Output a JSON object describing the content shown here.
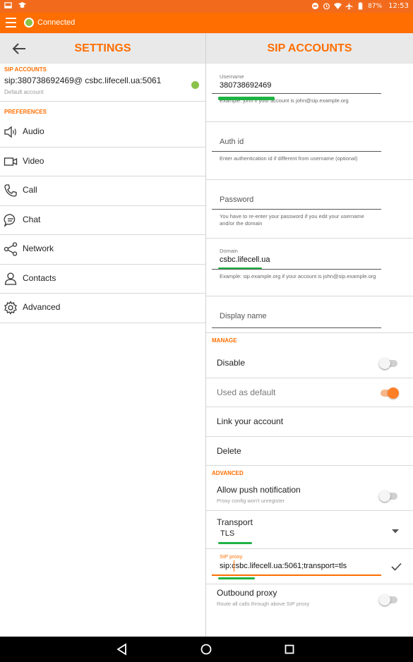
{
  "status_bar": {
    "battery": "87%",
    "time": "12:53"
  },
  "app_bar": {
    "connection_status": "Connected",
    "status_color": "#8bc34a",
    "accent": "#ff6e00"
  },
  "settings": {
    "title": "SETTINGS",
    "sip_section": "SIP ACCOUNTS",
    "account": {
      "address": "sip:380738692469@ csbc.lifecell.ua:5061",
      "subtitle": "Default account"
    },
    "pref_section": "PREFERENCES",
    "items": [
      {
        "label": "Audio",
        "icon": "speaker-icon"
      },
      {
        "label": "Video",
        "icon": "video-camera-icon"
      },
      {
        "label": "Call",
        "icon": "phone-icon"
      },
      {
        "label": "Chat",
        "icon": "chat-bubble-icon"
      },
      {
        "label": "Network",
        "icon": "share-network-icon"
      },
      {
        "label": "Contacts",
        "icon": "person-icon"
      },
      {
        "label": "Advanced",
        "icon": "gear-icon"
      }
    ]
  },
  "sip_account": {
    "title": "SIP ACCOUNTS",
    "username": {
      "label": "Username",
      "value": "380738692469",
      "hint": "Example: john if your account is john@sip.example.org"
    },
    "auth_id": {
      "placeholder": "Auth id",
      "hint": "Enter authentication id if different from username (optional)"
    },
    "password": {
      "placeholder": "Password",
      "hint": "You have to re-enter your password if you edit your username and/or the domain"
    },
    "domain": {
      "label": "Domain",
      "value": "csbc.lifecell.ua",
      "hint": "Example: sip.example.org if your account is john@sip.example.org"
    },
    "display_name": {
      "placeholder": "Display name"
    },
    "manage_section": "MANAGE",
    "disable": {
      "label": "Disable",
      "on": false
    },
    "used_as_default": {
      "label": "Used as default",
      "on": true
    },
    "link_account": "Link your account",
    "delete": "Delete",
    "advanced_section": "ADVANCED",
    "push": {
      "label": "Allow push notification",
      "subtitle": "Proxy config won't unregister",
      "on": false
    },
    "transport": {
      "label": "Transport",
      "value": "TLS"
    },
    "sip_proxy": {
      "label": "SIP proxy",
      "value": "sip:csbc.lifecell.ua:5061;transport=tls"
    },
    "outbound": {
      "label": "Outbound proxy",
      "subtitle": "Route all calls through above SIP proxy",
      "on": false
    }
  }
}
